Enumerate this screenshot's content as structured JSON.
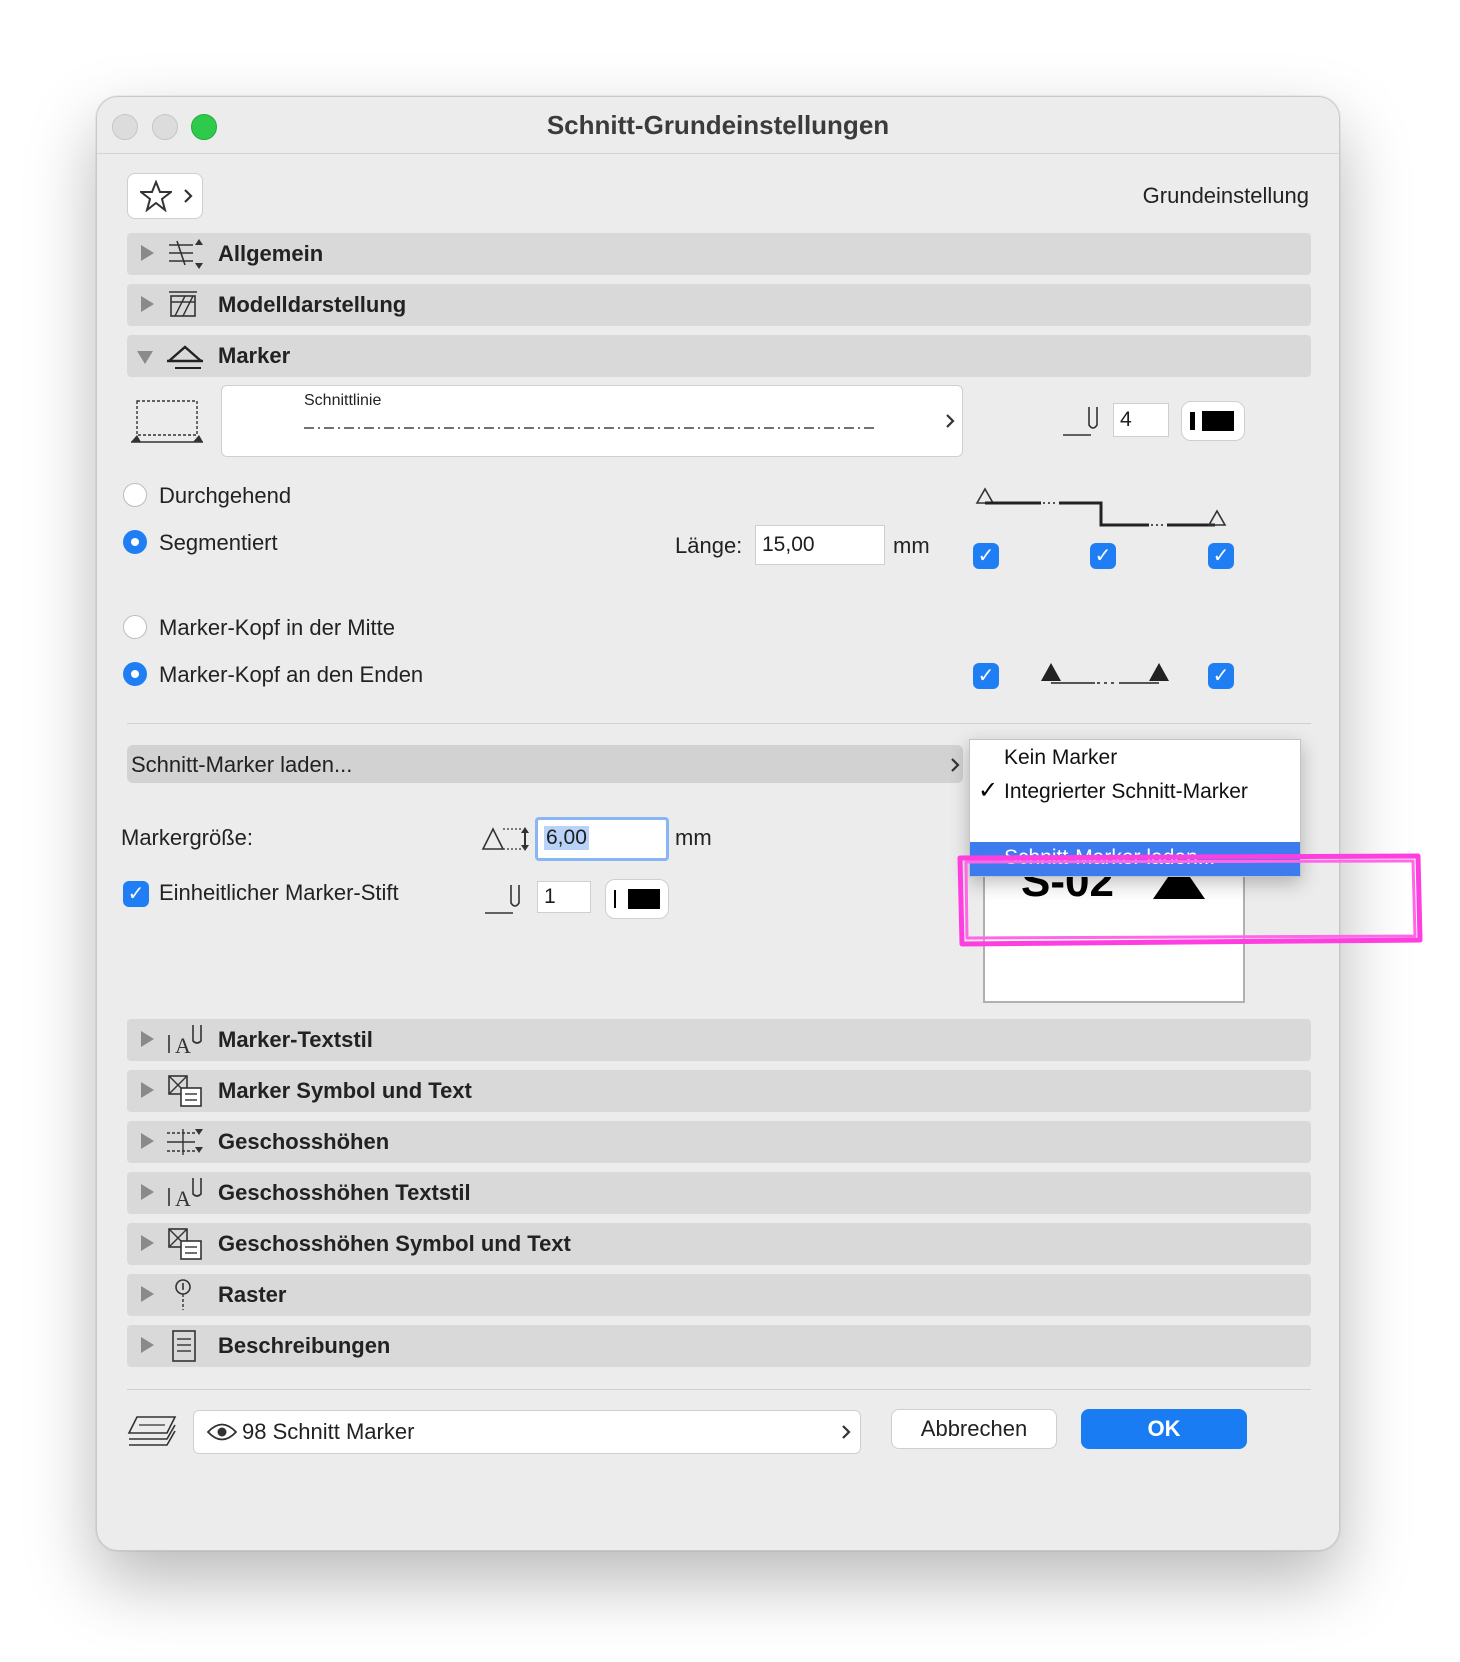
{
  "window": {
    "title": "Schnitt-Grundeinstellungen"
  },
  "header": {
    "favorites_icon": "star-icon",
    "default_label": "Grundeinstellung"
  },
  "sections_top": [
    {
      "label": "Allgemein",
      "icon": "general-settings-icon",
      "expanded": false
    },
    {
      "label": "Modelldarstellung",
      "icon": "model-display-icon",
      "expanded": false
    },
    {
      "label": "Marker",
      "icon": "marker-icon",
      "expanded": true
    }
  ],
  "marker": {
    "line_type_label": "Schnittlinie",
    "pen_value": "4",
    "radio_continuous": "Durchgehend",
    "radio_segmented": "Segmentiert",
    "length_label": "Länge:",
    "length_value": "15,00",
    "length_unit": "mm",
    "radio_head_middle": "Marker-Kopf in der Mitte",
    "radio_head_ends": "Marker-Kopf an den Enden",
    "load_marker_label": "Schnitt-Marker laden...",
    "size_label": "Markergröße:",
    "size_value": "6,00",
    "size_unit": "mm",
    "uniform_pen_label": "Einheitlicher Marker-Stift",
    "uniform_pen_value": "1",
    "preview_text": "S-02"
  },
  "dropdown": {
    "items": [
      "Kein Marker",
      "Integrierter Schnitt-Marker",
      "Schnitt-Marker laden..."
    ],
    "checked_index": 1,
    "highlight_index": 2
  },
  "sections_bottom": [
    {
      "label": "Marker-Textstil",
      "icon": "text-style-icon"
    },
    {
      "label": "Marker Symbol und Text",
      "icon": "symbol-text-icon"
    },
    {
      "label": "Geschosshöhen",
      "icon": "story-levels-icon"
    },
    {
      "label": "Geschosshöhen Textstil",
      "icon": "text-style-icon"
    },
    {
      "label": "Geschosshöhen Symbol und Text",
      "icon": "symbol-text-icon"
    },
    {
      "label": "Raster",
      "icon": "grid-icon"
    },
    {
      "label": "Beschreibungen",
      "icon": "description-icon"
    }
  ],
  "footer": {
    "layer_label": "98 Schnitt Marker",
    "cancel_label": "Abbrechen",
    "ok_label": "OK"
  },
  "colors": {
    "accent": "#1f7ef3",
    "highlight": "#3d7bef",
    "annotation": "#ff3ee0"
  }
}
